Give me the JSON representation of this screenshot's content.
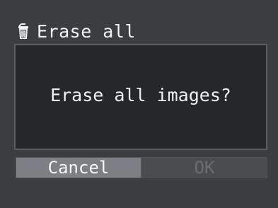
{
  "screen": {
    "title": "Erase all",
    "title_icon": "trash-icon",
    "question": "Erase all images?"
  },
  "buttons": {
    "cancel_label": "Cancel",
    "ok_label": "OK",
    "selected": "Cancel"
  },
  "colors": {
    "selected_button": "#7d7f84",
    "disabled_button": "#4a4c50",
    "dialog_background": "#25272a"
  }
}
